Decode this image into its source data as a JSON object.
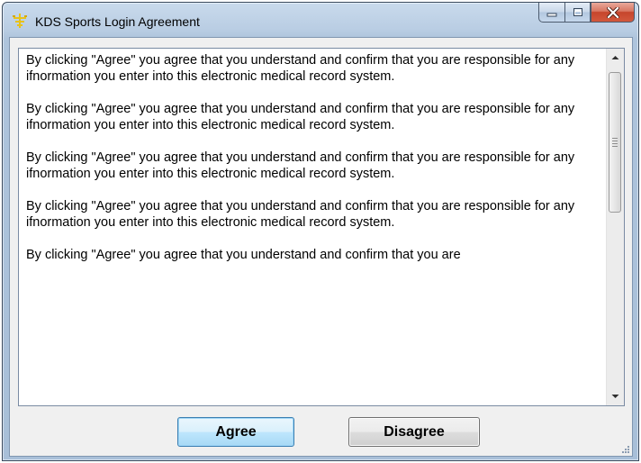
{
  "window": {
    "title": "KDS Sports Login Agreement",
    "icon": "kds-logo-icon",
    "caption_buttons": [
      "minimize-icon",
      "maximize-icon",
      "close-icon"
    ]
  },
  "agreement": {
    "paragraphs": [
      "By clicking \"Agree\" you agree that you understand and confirm that you are responsible for any ifnormation you enter into this electronic medical record system.",
      "By clicking \"Agree\" you agree that you understand and confirm that you are responsible for any ifnormation you enter into this electronic medical record system.",
      "By clicking \"Agree\" you agree that you understand and confirm that you are responsible for any ifnormation you enter into this electronic medical record system.",
      "By clicking \"Agree\" you agree that you understand and confirm that you are responsible for any ifnormation you enter into this electronic medical record system.",
      "By clicking \"Agree\" you agree that you understand and confirm that you are"
    ]
  },
  "buttons": {
    "agree_label": "Agree",
    "disagree_label": "Disagree"
  },
  "colors": {
    "title_bar": "#b9cde3",
    "close_button": "#c6452c",
    "agree_focus_border": "#3c7fb1",
    "icon_yellow": "#e8c21a"
  }
}
